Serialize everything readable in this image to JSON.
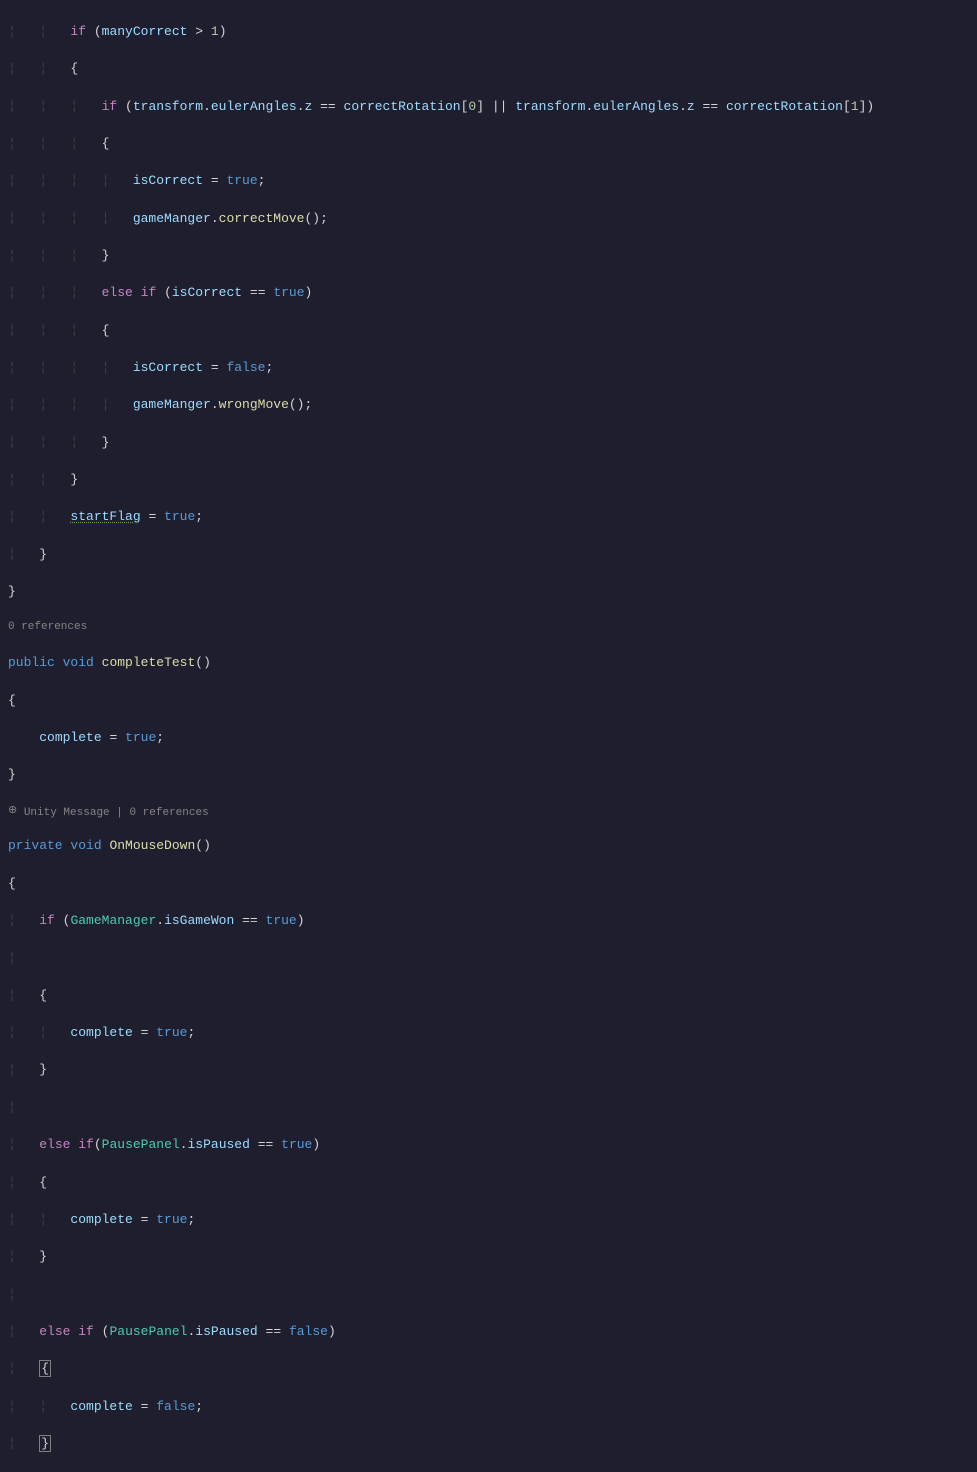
{
  "code": {
    "l1_if": "if",
    "l1_var": "manyCorrect",
    "l1_op": " > ",
    "l1_num": "1",
    "l3_if": "if",
    "l3_t1": "transform",
    "l3_ea1": "eulerAngles",
    "l3_z1": "z",
    "l3_eq": " == ",
    "l3_cr": "correctRotation",
    "l3_idx0": "0",
    "l3_or": " || ",
    "l3_idx1": "1",
    "l5_ic": "isCorrect",
    "l5_eq": " = ",
    "l5_true": "true",
    "l6_gm": "gameManger",
    "l6_cm": "correctMove",
    "l8_else": "else",
    "l8_if": "if",
    "l8_true": "true",
    "l10_false": "false",
    "l11_wm": "wrongMove",
    "l14_sf": "startFlag",
    "l14_true": "true",
    "ref0": "0 references",
    "l18_public": "public",
    "l18_void": "void",
    "l18_ct": "completeTest",
    "l20_complete": "complete",
    "l20_true": "true",
    "unity_msg": "Unity Message",
    "sep": " | ",
    "ref0b": "0 references",
    "l23_private": "private",
    "l23_void": "void",
    "l23_omd": "OnMouseDown",
    "l25_if": "if",
    "l25_gm": "GameManager",
    "l25_igw": "isGameWon",
    "l25_true": "true",
    "l28_true": "true",
    "l31_else": "else",
    "l31_if": "if",
    "l31_pp": "PausePanel",
    "l31_ip": "isPaused",
    "l31_true": "true",
    "l33_true": "true",
    "l36_else": "else",
    "l36_if": "if",
    "l36_false": "false",
    "l38_false": "false"
  }
}
